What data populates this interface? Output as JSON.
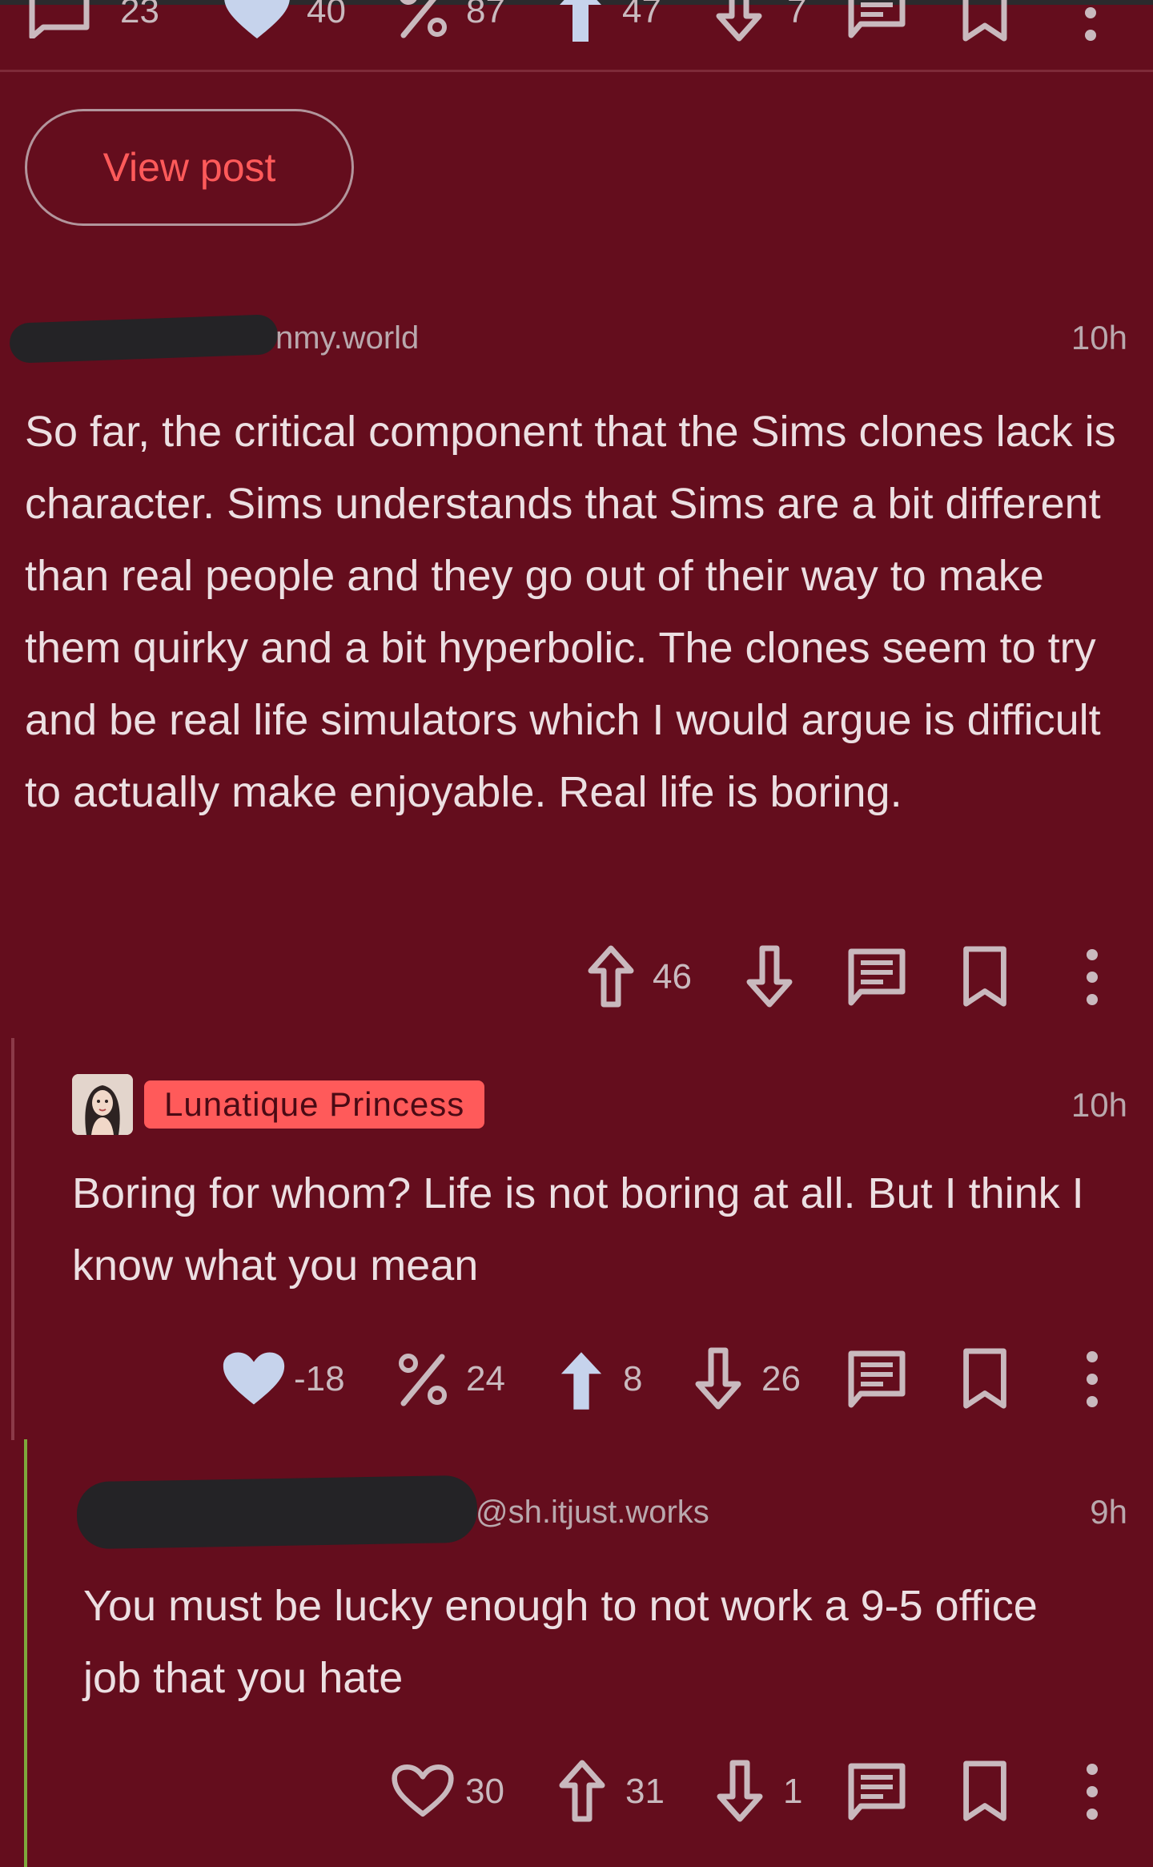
{
  "colors": {
    "background": "#640d1d",
    "text": "#ecdfe2",
    "muted": "#b9a8ad",
    "accent": "#ff5a5a",
    "icon": "#c9b9be",
    "heart_filled": "#c6d3ec",
    "thread_line_1": "#8b3a48",
    "thread_line_2": "#7ea83c"
  },
  "top_actions": {
    "comments_count": "23",
    "likes_count": "40",
    "ratio_count": "87",
    "upvotes_count": "47",
    "downvotes_count": "7"
  },
  "view_post_label": "View post",
  "comment1": {
    "author_suffix": "nmy.world",
    "time": "10h",
    "body": "So far, the critical component that the Sims clones lack is character. Sims understands that Sims are a bit different than real people and they go out of their way to make them quirky and a bit hyperbolic. The clones seem to try and be real life simulators which I would argue is difficult to actually make enjoyable. Real life is boring.",
    "upvotes": "46",
    "icons": [
      "upvote-icon",
      "downvote-icon",
      "reply-icon",
      "bookmark-icon",
      "more-icon"
    ]
  },
  "comment2": {
    "author": "Lunatique Princess",
    "time": "10h",
    "body": "Boring for whom? Life is not boring at all. But I think I know what you mean",
    "likes": "-18",
    "ratio": "24",
    "upvotes": "8",
    "downvotes": "26"
  },
  "comment3": {
    "author_suffix": "@sh.itjust.works",
    "time": "9h",
    "body": "You must be lucky enough to not work a 9-5 office job that you hate",
    "likes": "30",
    "upvotes": "31",
    "downvotes": "1"
  }
}
